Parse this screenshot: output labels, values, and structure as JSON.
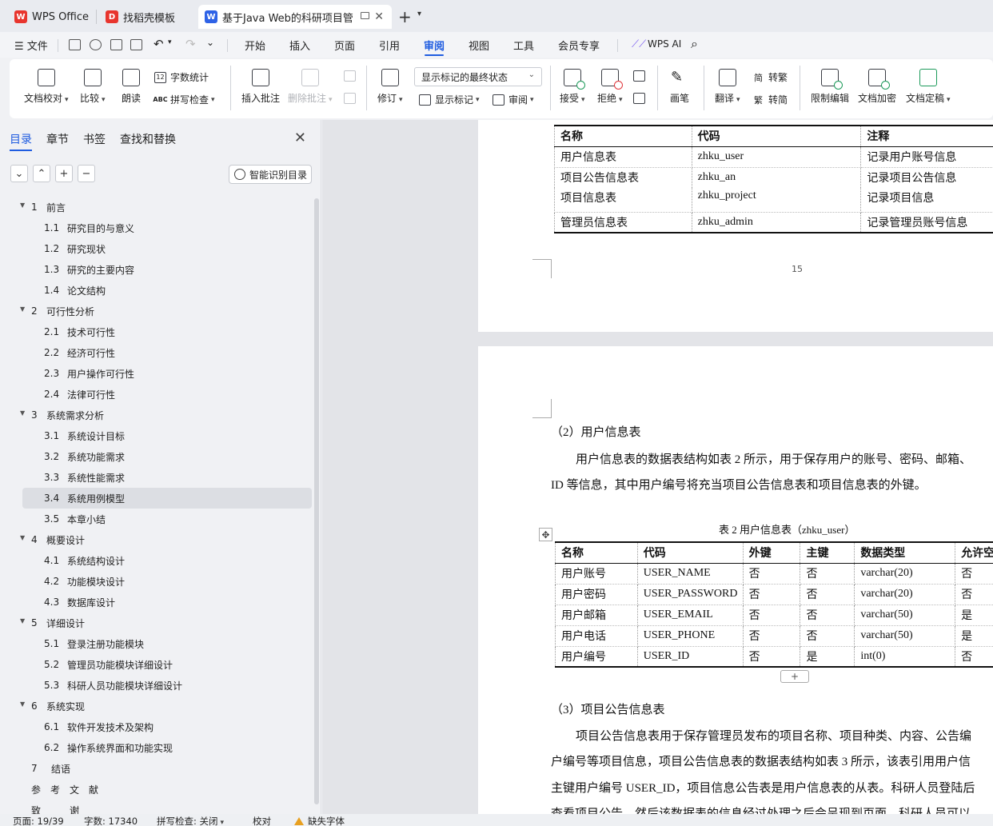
{
  "tabs": [
    {
      "label": "WPS Office",
      "icon": "wps-logo-icon",
      "active": false
    },
    {
      "label": "找稻壳模板",
      "icon": "docer-logo-icon",
      "active": false
    },
    {
      "label": "基于Java Web的科研项目管理",
      "icon": "writer-logo-icon",
      "active": true
    }
  ],
  "menu": {
    "file": "文件",
    "items": [
      "开始",
      "插入",
      "页面",
      "引用",
      "审阅",
      "视图",
      "工具",
      "会员专享"
    ],
    "active": "审阅",
    "wps_ai": "WPS AI"
  },
  "ribbon": {
    "doc_proof": "文档校对",
    "compare": "比较",
    "read_aloud": "朗读",
    "word_count": "字数统计",
    "spell_check": "拼写检查",
    "insert_comment": "插入批注",
    "delete_comment": "删除批注",
    "track_changes": "修订",
    "markup_state": "显示标记的最终状态",
    "show_markup": "显示标记",
    "review": "审阅",
    "accept": "接受",
    "reject": "拒绝",
    "pen": "画笔",
    "translate": "翻译",
    "to_traditional": "转繁",
    "to_simplified": "转简",
    "restrict_edit": "限制编辑",
    "encrypt": "文档加密",
    "finalize": "文档定稿"
  },
  "nav": {
    "tabs": [
      "目录",
      "章节",
      "书签",
      "查找和替换"
    ],
    "smart_toc": "智能识别目录",
    "toc": [
      {
        "num": "1",
        "text": "前言",
        "level": 1
      },
      {
        "num": "1.1",
        "text": "研究目的与意义",
        "level": 2
      },
      {
        "num": "1.2",
        "text": "研究现状",
        "level": 2
      },
      {
        "num": "1.3",
        "text": "研究的主要内容",
        "level": 2
      },
      {
        "num": "1.4",
        "text": "论文结构",
        "level": 2
      },
      {
        "num": "2",
        "text": "可行性分析",
        "level": 1
      },
      {
        "num": "2.1",
        "text": "技术可行性",
        "level": 2
      },
      {
        "num": "2.2",
        "text": "经济可行性",
        "level": 2
      },
      {
        "num": "2.3",
        "text": "用户操作可行性",
        "level": 2
      },
      {
        "num": "2.4",
        "text": "法律可行性",
        "level": 2
      },
      {
        "num": "3",
        "text": "系统需求分析",
        "level": 1
      },
      {
        "num": "3.1",
        "text": "系统设计目标",
        "level": 2
      },
      {
        "num": "3.2",
        "text": "系统功能需求",
        "level": 2
      },
      {
        "num": "3.3",
        "text": "系统性能需求",
        "level": 2
      },
      {
        "num": "3.4",
        "text": "系统用例模型",
        "level": 2,
        "selected": true
      },
      {
        "num": "3.5",
        "text": "本章小结",
        "level": 2
      },
      {
        "num": "4",
        "text": "概要设计",
        "level": 1
      },
      {
        "num": "4.1",
        "text": "系统结构设计",
        "level": 2
      },
      {
        "num": "4.2",
        "text": "功能模块设计",
        "level": 2
      },
      {
        "num": "4.3",
        "text": "数据库设计",
        "level": 2
      },
      {
        "num": "5",
        "text": "详细设计",
        "level": 1
      },
      {
        "num": "5.1",
        "text": "登录注册功能模块",
        "level": 2
      },
      {
        "num": "5.2",
        "text": "管理员功能模块详细设计",
        "level": 2
      },
      {
        "num": "5.3",
        "text": "科研人员功能模块详细设计",
        "level": 2
      },
      {
        "num": "6",
        "text": "系统实现",
        "level": 1
      },
      {
        "num": "6.1",
        "text": "软件开发技术及架构",
        "level": 2
      },
      {
        "num": "6.2",
        "text": "操作系统界面和功能实现",
        "level": 2
      },
      {
        "num": "7",
        "text": "结语",
        "level": 0
      },
      {
        "num": "",
        "text": "参　考　文　献",
        "level": 0
      },
      {
        "num": "",
        "text": "致　　　谢",
        "level": 0
      }
    ]
  },
  "doc": {
    "table1": {
      "headers": [
        "名称",
        "代码",
        "注释"
      ],
      "rows": [
        [
          "用户信息表",
          "zhku_user",
          "记录用户账号信息"
        ],
        [
          "项目公告信息表",
          "zhku_an",
          "记录项目公告信息"
        ],
        [
          "项目信息表",
          "zhku_project",
          "记录项目信息"
        ],
        [
          "管理员信息表",
          "zhku_admin",
          "记录管理员账号信息"
        ]
      ]
    },
    "page_number": "15",
    "section2_title": "（2）用户信息表",
    "section2_line1": "用户信息表的数据表结构如表 2 所示，用于保存用户的账号、密码、邮箱、",
    "section2_line2": "ID 等信息，其中用户编号将充当项目公告信息表和项目信息表的外键。",
    "table2_caption": "表 2  用户信息表（zhku_user）",
    "table2": {
      "headers": [
        "名称",
        "代码",
        "外键",
        "主键",
        "数据类型",
        "允许空"
      ],
      "rows": [
        [
          "用户账号",
          "USER_NAME",
          "否",
          "否",
          "varchar(20)",
          "否"
        ],
        [
          "用户密码",
          "USER_PASSWORD",
          "否",
          "否",
          "varchar(20)",
          "否"
        ],
        [
          "用户邮箱",
          "USER_EMAIL",
          "否",
          "否",
          "varchar(50)",
          "是"
        ],
        [
          "用户电话",
          "USER_PHONE",
          "否",
          "否",
          "varchar(50)",
          "是"
        ],
        [
          "用户编号",
          "USER_ID",
          "否",
          "是",
          "int(0)",
          "否"
        ]
      ]
    },
    "section3_title": "（3）项目公告信息表",
    "section3_line1": "项目公告信息表用于保存管理员发布的项目名称、项目种类、内容、公告编",
    "section3_line2": "户编号等项目信息，项目公告信息表的数据表结构如表 3 所示，该表引用用户信",
    "section3_line3": "主键用户编号 USER_ID，项目信息公告表是用户信息表的从表。科研人员登陆后",
    "section3_line4": "查看项目公告，然后该数据表的信息经过处理之后会呈现到页面，科研人员可以"
  },
  "status": {
    "page": "页面: 19/39",
    "words": "字数: 17340",
    "spell": "拼写检查: 关闭",
    "proof": "校对",
    "missing_font": "缺失字体"
  }
}
